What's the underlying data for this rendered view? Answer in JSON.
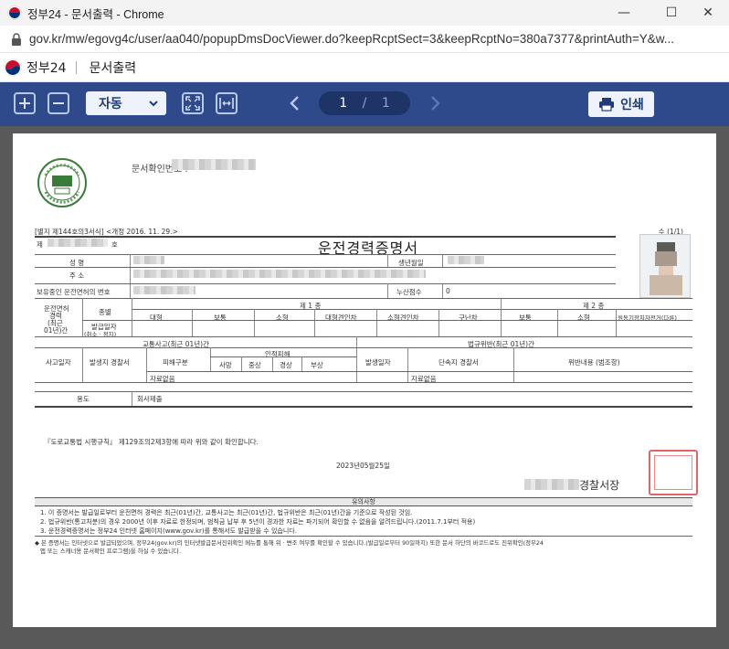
{
  "window": {
    "title": "정부24 - 문서출력 - Chrome",
    "minimize": "—",
    "maximize": "☐",
    "close": "✕"
  },
  "address": {
    "url": "gov.kr/mw/egovg4c/user/aa040/popupDmsDocViewer.do?keepRcptSect=3&keepRcptNo=380a7377&printAuth=Y&w..."
  },
  "site": {
    "brand": "정부24",
    "page_title": "문서출력"
  },
  "toolbar": {
    "zoom_value": "자동",
    "current_page": "1",
    "page_separator": "/",
    "total_pages": "1",
    "print_label": "인쇄"
  },
  "document": {
    "doc_number_label": "문서확인번호 :",
    "form_number": "[별지 제144호의3서식] <개정 2016. 11. 29.>",
    "page_count": "수 (1/1)",
    "title": "운전경력증명서",
    "row_je": "제",
    "row_ho": "호",
    "name_label": "성    명",
    "birth_label": "생년월일",
    "address_label": "주    소",
    "license_label": "보유중인 운전면허의 번호",
    "penalty_label": "누산점수",
    "penalty_value": "0",
    "history_label_1": "운전면허",
    "history_label_2": "경력",
    "history_label_3": "(최근",
    "history_label_4": "01년)간",
    "type_label": "종별",
    "class1_label": "제 1 종",
    "class2_label": "제 2 종",
    "class1_cols": [
      "대형",
      "보통",
      "소형",
      "대형견인차",
      "소형견인차",
      "구난차"
    ],
    "class2_cols": [
      "보통",
      "소형",
      "원동기장치자전거(다륜)"
    ],
    "issue_date_label_1": "발급일자",
    "issue_date_label_2": "(취소 · 정지)",
    "accident_label": "교통사고(최근 01년)간",
    "violation_label": "법규위반(최근 01년)간",
    "accident_date_label": "사고일자",
    "occurrence_station_label": "발생지 경찰서",
    "damage_label": "피해구분",
    "injury_label": "인적피해",
    "injury_cols": [
      "사망",
      "중상",
      "경상",
      "부상"
    ],
    "occurrence_date_label": "발생일자",
    "enforcement_station_label": "단속지 경찰서",
    "violation_content_label": "위반내용 (범조항)",
    "no_data_1": "자료없음",
    "no_data_2": "자료없음",
    "purpose_label": "용도",
    "purpose_value": "회사제출",
    "confirm_text": "『도로교통법 시행규칙』 제129조의2제3항에 따라 위와 같이 확인합니다.",
    "issue_date": "2023년05월25일",
    "issuer": "경찰서장",
    "notes_title": "유의사항",
    "notes": [
      "1. 이 증명서는 발급일로부터 운전면허 경력은 최근(01년)간, 교통사고는 최근(01년)간, 법규위반은 최근(01년)간을 기준으로 작성된 것임.",
      "2. 법규위반(통고처분)의 경우 2000년 이후 자료로 한정되며, 범칙금 납부 후 5년이 경과한 자료는 파기되어 확인할 수 없음을 알려드립니다.(2011.7.1부터 적용)",
      "3. 운전경력증명서는 정부24 인터넷 홈페이지(www.gov.kr)를 통해서도 발급받을 수 있습니다."
    ],
    "footnote_1": "◆ 본 증명서는 인터넷으로 발급되었으며, 정부24(gov.kr)의 인터넷발급문서진위확인 메뉴를 통해 위 · 변조 여부를 확인할 수 있습니다.(발급일로부터 90일까지) 또한 문서 하단의 바코드로도 진위확인(정부24",
    "footnote_2": "앱 또는 스캐너용 문서확인 프로그램)을 하실 수 있습니다."
  },
  "colors": {
    "toolbar_bg": "#2e4a8b",
    "viewer_bg": "#595959",
    "accent": "#1e3c7a"
  }
}
